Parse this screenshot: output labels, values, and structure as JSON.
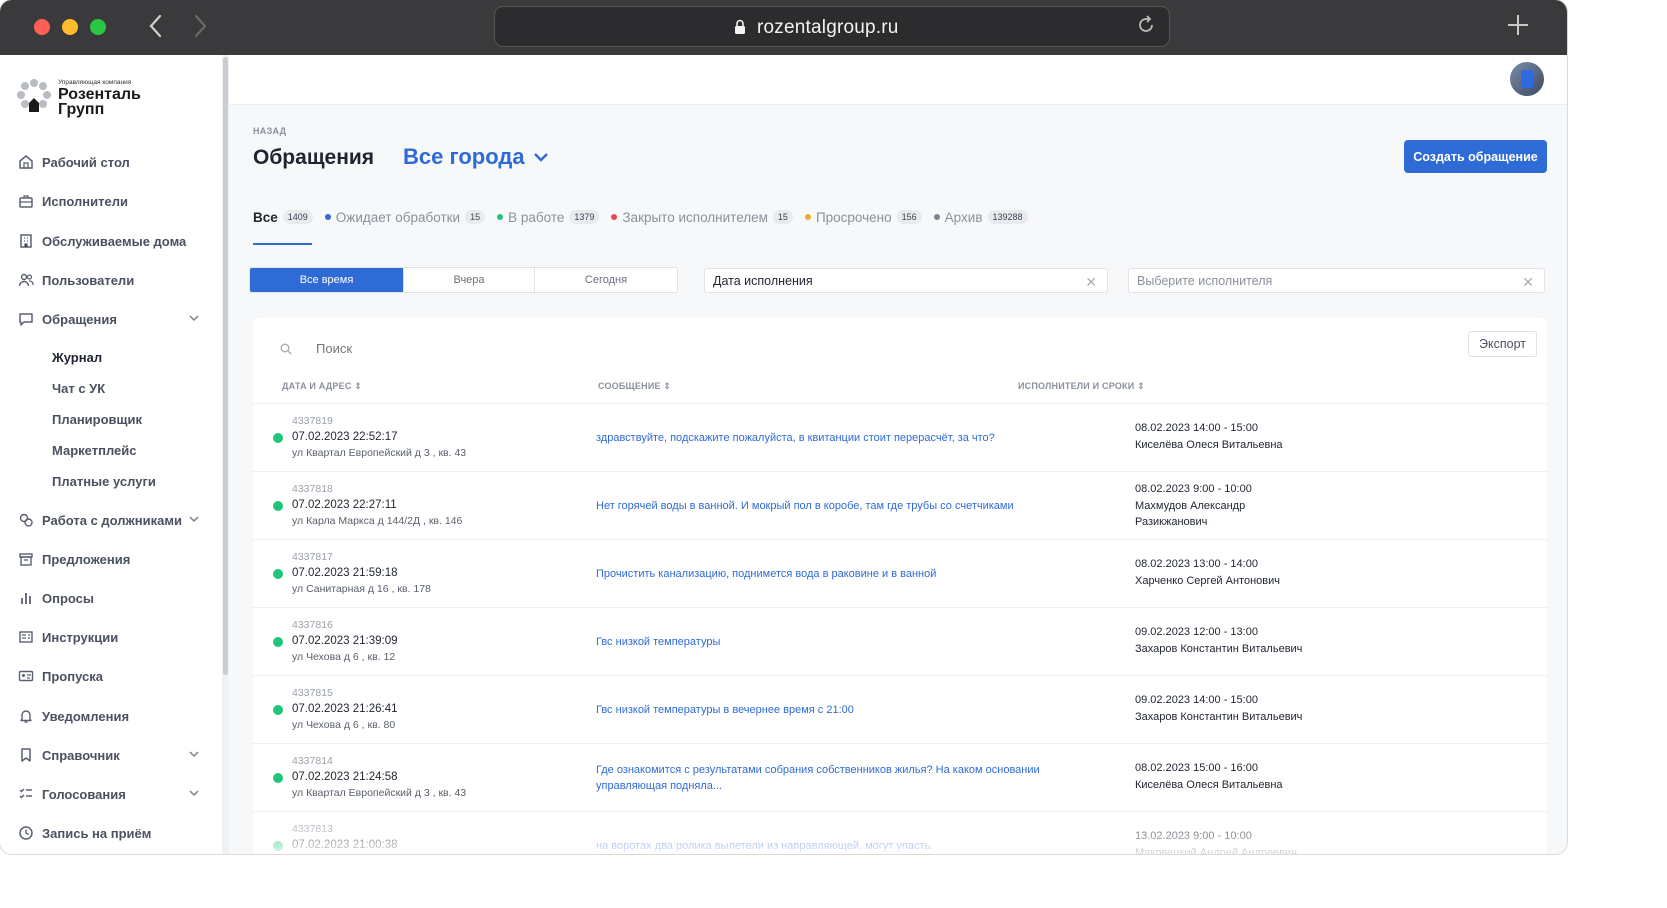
{
  "browser": {
    "url": "rozentalgroup.ru",
    "back_icon": "chevron-left-icon",
    "forward_icon": "chevron-right-icon",
    "reload_icon": "reload-icon",
    "new_tab_icon": "plus-icon"
  },
  "logo": {
    "small_text": "Управляющая компания",
    "name_line1": "Розенталь",
    "name_line2": "Групп"
  },
  "sidebar": {
    "items": [
      {
        "label": "Рабочий стол",
        "icon": "home-icon"
      },
      {
        "label": "Исполнители",
        "icon": "briefcase-icon"
      },
      {
        "label": "Обслуживаемые дома",
        "icon": "building-icon"
      },
      {
        "label": "Пользователи",
        "icon": "users-icon"
      },
      {
        "label": "Обращения",
        "icon": "message-icon",
        "expanded": true
      },
      {
        "label": "Работа с должниками",
        "icon": "debt-icon"
      },
      {
        "label": "Предложения",
        "icon": "inbox-icon"
      },
      {
        "label": "Опросы",
        "icon": "bar-chart-icon"
      },
      {
        "label": "Инструкции",
        "icon": "book-icon"
      },
      {
        "label": "Пропуска",
        "icon": "id-card-icon"
      },
      {
        "label": "Уведомления",
        "icon": "bell-icon"
      },
      {
        "label": "Справочник",
        "icon": "bookmark-icon"
      },
      {
        "label": "Голосования",
        "icon": "list-check-icon"
      },
      {
        "label": "Запись на приём",
        "icon": "clock-icon"
      }
    ],
    "subitems": [
      "Журнал",
      "Чат с УК",
      "Планировщик",
      "Маркетплейс",
      "Платные услуги"
    ]
  },
  "header": {
    "back": "НАЗАД",
    "title": "Обращения",
    "city": "Все города",
    "create_button": "Создать обращение"
  },
  "status_tabs": [
    {
      "label": "Все",
      "count": "1409",
      "color": null
    },
    {
      "label": "Ожидает обработки",
      "count": "15",
      "color": "#2f6bd6"
    },
    {
      "label": "В работе",
      "count": "1379",
      "color": "#1fc57c"
    },
    {
      "label": "Закрыто исполнителем",
      "count": "15",
      "color": "#e8474e"
    },
    {
      "label": "Просрочено",
      "count": "156",
      "color": "#f0a93b"
    },
    {
      "label": "Архив",
      "count": "139288",
      "color": "#7d8593"
    }
  ],
  "filters": {
    "period": [
      "Все время",
      "Вчера",
      "Сегодня"
    ],
    "date_field": "Дата исполнения",
    "executor_placeholder": "Выберите исполнителя"
  },
  "table": {
    "search_placeholder": "Поиск",
    "export_button": "Экспорт",
    "columns": [
      "ДАТА И АДРЕС ⇕",
      "СООБЩЕНИЕ ⇕",
      "ИСПОЛНИТЕЛИ И СРОКИ ⇕"
    ],
    "rows": [
      {
        "id": "4337819",
        "datetime": "07.02.2023 22:52:17",
        "address": "ул Квартал Европейский д 3 , кв. 43",
        "message": "здравствуйте, подскажите пожалуйста, в квитанции стоит перерасчёт, за что?",
        "time": "08.02.2023 14:00 - 15:00",
        "executor": "Киселёва Олеся Витальевна"
      },
      {
        "id": "4337818",
        "datetime": "07.02.2023 22:27:11",
        "address": "ул Карла Маркса д 144/2Д , кв. 146",
        "message": "Нет горячей воды в ванной. И мокрый пол в коробе, там где трубы со счетчиками",
        "time": "08.02.2023 9:00 - 10:00",
        "executor": "Махмудов Александр Разикжанович"
      },
      {
        "id": "4337817",
        "datetime": "07.02.2023 21:59:18",
        "address": "ул Санитарная д 16 , кв. 178",
        "message": "Прочистить канализацию, поднимется вода в раковине и в ванной",
        "time": "08.02.2023 13:00 - 14:00",
        "executor": "Харченко Сергей Антонович"
      },
      {
        "id": "4337816",
        "datetime": "07.02.2023 21:39:09",
        "address": "ул Чехова д 6 , кв. 12",
        "message": "Гвс низкой температуры",
        "time": "09.02.2023 12:00 - 13:00",
        "executor": "Захаров Константин Витальевич"
      },
      {
        "id": "4337815",
        "datetime": "07.02.2023 21:26:41",
        "address": "ул Чехова д 6 , кв. 80",
        "message": "Гвс низкой температуры в вечернее время с 21:00",
        "time": "09.02.2023 14:00 - 15:00",
        "executor": "Захаров Константин Витальевич"
      },
      {
        "id": "4337814",
        "datetime": "07.02.2023 21:24:58",
        "address": "ул Квартал Европейский д 3 , кв. 43",
        "message": "Где ознакомится с результатами собрания собственников жилья? На каком основании управляющая подняла...",
        "time": "08.02.2023 15:00 - 16:00",
        "executor": "Киселёва Олеся Витальевна"
      },
      {
        "id": "4337813",
        "datetime": "07.02.2023 21:00:38",
        "address": "",
        "message": "на воротах два ролика вылетели из направляющей. могут упасть.",
        "time": "13.02.2023 9:00 - 10:00",
        "executor": "Маковецкий Андрей Андреевич"
      }
    ]
  },
  "colors": {
    "accent": "#2f6bd6",
    "status_active": "#1fc57c"
  }
}
